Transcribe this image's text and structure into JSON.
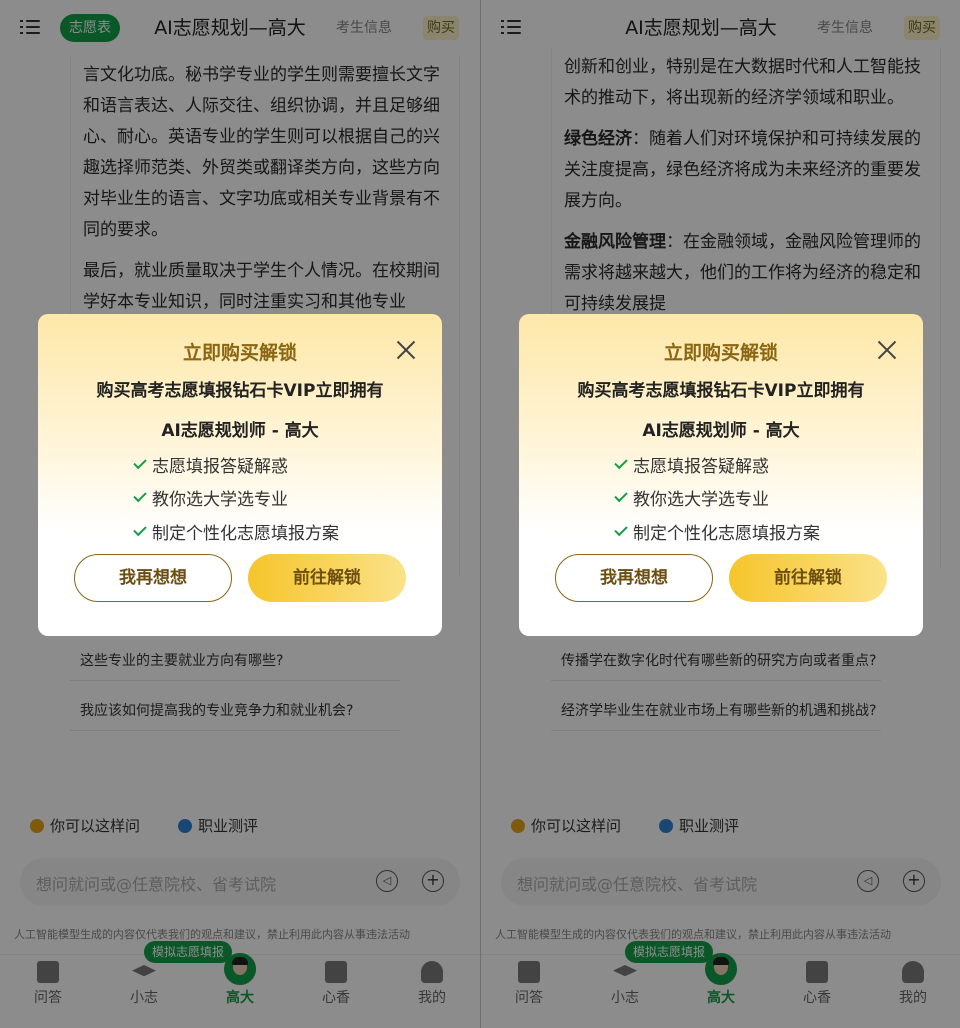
{
  "panels": [
    {
      "id": "left",
      "header": {
        "menu": "menu-icon",
        "tag": "志愿表",
        "title": "AI志愿规划—高大",
        "info": "考生信息",
        "buy": "购买"
      },
      "article": [
        {
          "text": "言文化功底。秘书学专业的学生则需要擅长文字和语言表达、人际交往、组织协调，并且足够细心、耐心。英语专业的学生则可以根据自己的兴趣选择师范类、外贸类或翻译类方向，这些方向对毕业生的语言、文字功底或相关专业背景有不同的要求。"
        },
        {
          "text": "最后，就业质量取决于学生个人情况。在校期间学好本专业知识，同时注重实习和其他专业"
        }
      ],
      "questions": [
        "这些专业的主要就业方向有哪些?",
        "我应该如何提高我的专业竞争力和就业机会?"
      ],
      "hints": [
        "你可以这样问",
        "职业测评"
      ],
      "input_placeholder": "想问就问或@任意院校、省考试院",
      "disclaimer": "人工智能模型生成的内容仅代表我们的观点和建议，禁止利用此内容从事违法活动",
      "sim_badge": "模拟志愿填报",
      "tabs": [
        "问答",
        "小志",
        "高大",
        "心香",
        "我的"
      ],
      "modal": {
        "title": "立即购买解锁",
        "sub": "购买高考志愿填报钻石卡VIP立即拥有",
        "sub2": "AI志愿规划师 - 高大",
        "features": [
          "志愿填报答疑解惑",
          "教你选大学选专业",
          "制定个性化志愿填报方案"
        ],
        "btn_think": "我再想想",
        "btn_unlock": "前往解锁"
      }
    },
    {
      "id": "right",
      "header": {
        "menu": "menu-icon",
        "title": "AI志愿规划—高大",
        "info": "考生信息",
        "buy": "购买"
      },
      "article": [
        {
          "text": "创新和创业，特别是在大数据时代和人工智能技术的推动下，将出现新的经济学领域和职业。"
        },
        {
          "bold": "绿色经济",
          "text": "：随着人们对环境保护和可持续发展的关注度提高，绿色经济将成为未来经济的重要发展方向。"
        },
        {
          "bold": "金融风险管理",
          "text": "：在金融领域，金融风险管理师的需求将越来越大，他们的工作将为经济的稳定和可持续发展提"
        }
      ],
      "questions": [
        "传播学在数字化时代有哪些新的研究方向或者重点?",
        "经济学毕业生在就业市场上有哪些新的机遇和挑战?"
      ],
      "hints": [
        "你可以这样问",
        "职业测评"
      ],
      "input_placeholder": "想问就问或@任意院校、省考试院",
      "disclaimer": "人工智能模型生成的内容仅代表我们的观点和建议，禁止利用此内容从事违法活动",
      "sim_badge": "模拟志愿填报",
      "tabs": [
        "问答",
        "小志",
        "高大",
        "心香",
        "我的"
      ],
      "modal": {
        "title": "立即购买解锁",
        "sub": "购买高考志愿填报钻石卡VIP立即拥有",
        "sub2": "AI志愿规划师 - 高大",
        "features": [
          "志愿填报答疑解惑",
          "教你选大学选专业",
          "制定个性化志愿填报方案"
        ],
        "btn_think": "我再想想",
        "btn_unlock": "前往解锁"
      }
    }
  ],
  "colors": {
    "brand_green": "#13a04a",
    "gold": "#8a6512",
    "button_yellow": "#f6c52b"
  }
}
